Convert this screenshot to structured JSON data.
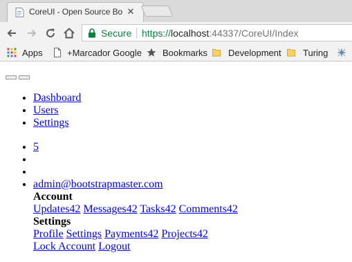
{
  "browser": {
    "tab": {
      "title": "CoreUI - Open Source Bo",
      "close_glyph": "✕"
    },
    "toolbar": {
      "secure_label": "Secure",
      "url_scheme": "https://",
      "url_host": "localhost",
      "url_rest": ":44337/CoreUI/Index"
    },
    "bookmarks": [
      {
        "label": "Apps",
        "icon": "apps-grid-icon"
      },
      {
        "label": "+Marcador Google",
        "icon": "page-icon"
      },
      {
        "label": "Bookmarks",
        "icon": "star-icon"
      },
      {
        "label": "Development",
        "icon": "folder-icon"
      },
      {
        "label": "Turing",
        "icon": "folder-icon"
      }
    ],
    "colors": {
      "secure_green": "#0b8043",
      "link_blue": "#0000ee",
      "folder_yellow": "#f7d26a"
    }
  },
  "page": {
    "nav": [
      "Dashboard",
      "Users",
      "Settings"
    ],
    "badge": "5",
    "user_email": "admin@bootstrapmaster.com",
    "dropdown": {
      "account_header": "Account",
      "account_links": [
        "Updates42",
        "Messages42",
        "Tasks42",
        "Comments42"
      ],
      "settings_header": "Settings",
      "settings_links": [
        "Profile",
        "Settings",
        "Payments42",
        "Projects42"
      ],
      "footer_links": [
        "Lock Account",
        "Logout"
      ]
    }
  }
}
